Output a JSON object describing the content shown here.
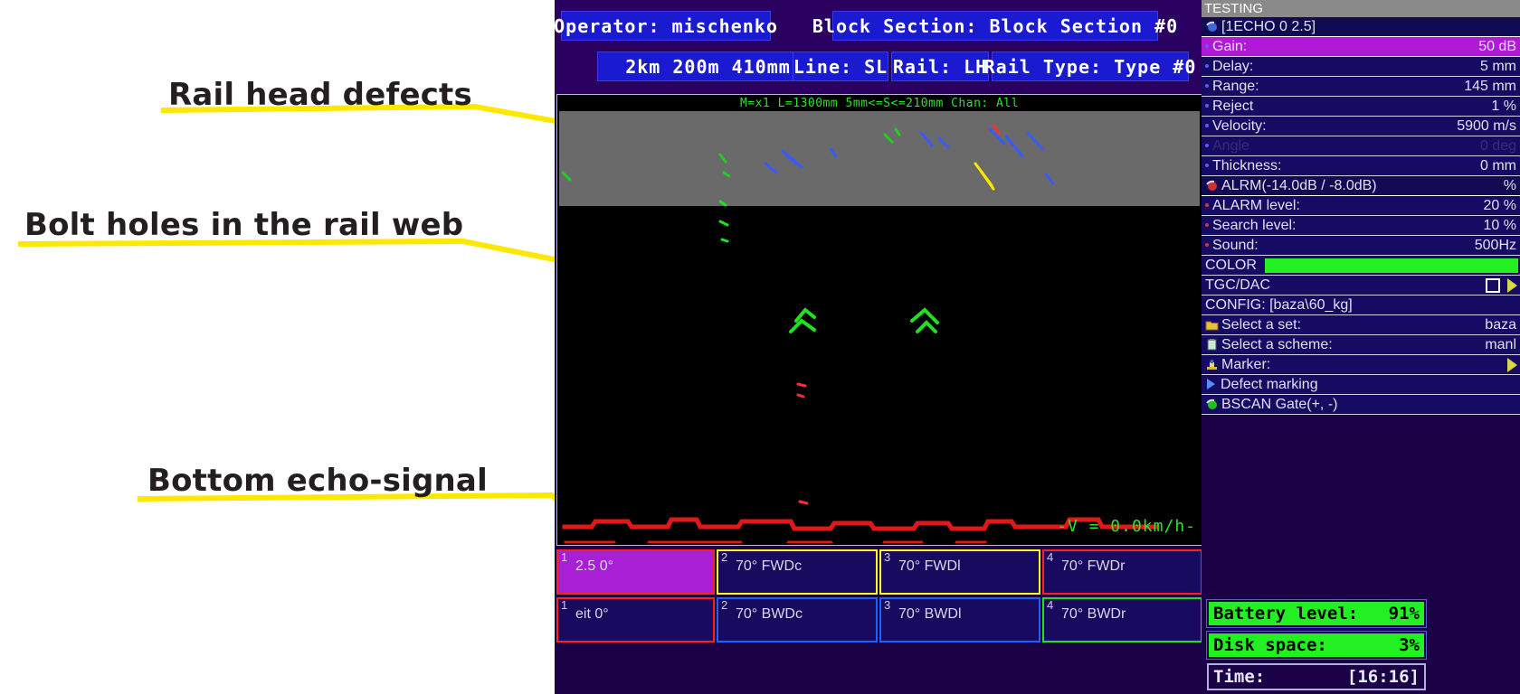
{
  "annotations": [
    {
      "text": "Rail head defects",
      "name": "annotation-rail-head-defects"
    },
    {
      "text": "Bolt holes in the rail web",
      "name": "annotation-bolt-holes"
    },
    {
      "text": "Bottom echo-signal",
      "name": "annotation-bottom-echo"
    }
  ],
  "colors": {
    "annotation_line": "#ffe800",
    "panel_bg": "#1b0246",
    "row_bg": "#160b62",
    "selected_row": "#b01ad6",
    "status_green": "#22f022",
    "bscan_head_bg": "#6a6a6a",
    "header_field_bg": "#1a1ad0"
  },
  "header": {
    "operator": "Operator: mischenko",
    "block_section": "Block Section: Block Section #0",
    "position": "2km  200m  410mm",
    "line": "Line: SL",
    "rail": "Rail: LH",
    "rail_type": "Rail Type: Type #0"
  },
  "bscan": {
    "title": "M=x1  L=1300mm 5mm<=S<=210mm Chan: All",
    "speed": "-V = 0.0km/h-"
  },
  "panel": {
    "title": "TESTING",
    "echo_header": "[1ECHO 0 2.5]",
    "rows": [
      {
        "name": "Gain:",
        "value": "50 dB",
        "selected": true,
        "bullet": "blue"
      },
      {
        "name": "Delay:",
        "value": "5 mm",
        "selected": false,
        "bullet": "blue"
      },
      {
        "name": "Range:",
        "value": "145 mm",
        "selected": false,
        "bullet": "blue"
      },
      {
        "name": "Reject",
        "value": "1 %",
        "selected": false,
        "bullet": "blue"
      },
      {
        "name": "Velocity:",
        "value": "5900 m/s",
        "selected": false,
        "bullet": "blue"
      },
      {
        "name": "Angle",
        "value": "0 deg",
        "selected": false,
        "bullet": "blue",
        "dim": true
      },
      {
        "name": "Thickness:",
        "value": "0 mm",
        "selected": false,
        "bullet": "blue"
      }
    ],
    "alarm_header": {
      "name": "ALRM(-14.0dB / -8.0dB)",
      "value": "%"
    },
    "alarm_rows": [
      {
        "name": "ALARM level:",
        "value": "20 %",
        "bullet": "red"
      },
      {
        "name": "Search level:",
        "value": "10 %",
        "bullet": "red"
      },
      {
        "name": "Sound:",
        "value": "500Hz",
        "bullet": "red"
      }
    ],
    "color_row": {
      "name": "COLOR",
      "swatch": "#22f022"
    },
    "tgcdac_row": {
      "name": "TGC/DAC"
    },
    "config_row": {
      "name": "CONFIG: [baza\\60_kg]"
    },
    "set_row": {
      "name": "Select a set:",
      "value": "baza",
      "icon": "folder-icon"
    },
    "scheme_row": {
      "name": "Select a scheme:",
      "value": "manl",
      "icon": "clipboard-icon"
    },
    "marker_row": {
      "name": "Marker:",
      "icon": "marker-icon"
    },
    "defect_row": {
      "name": "Defect marking",
      "icon": "play-arrow-icon"
    },
    "gate_row": {
      "name": "BSCAN Gate(+, -)",
      "icon": "gate-icon"
    }
  },
  "status": {
    "battery": {
      "label": "Battery level:",
      "value": "91%"
    },
    "disk": {
      "label": "Disk space:",
      "value": "3%"
    },
    "time": {
      "label": "Time:",
      "value": "[16:16]"
    }
  },
  "channels": {
    "row1": [
      {
        "num": "1",
        "label": "2.5 0°",
        "active": true,
        "border": "#ff2020"
      },
      {
        "num": "2",
        "label": "70° FWDc",
        "active": false,
        "border": "#ffff20"
      },
      {
        "num": "3",
        "label": "70° FWDl",
        "active": false,
        "border": "#ffff20"
      },
      {
        "num": "4",
        "label": "70° FWDr",
        "active": false,
        "border": "#ff2020"
      }
    ],
    "row2": [
      {
        "num": "1",
        "label": "eit 0°",
        "active": false,
        "border": "#ff2020"
      },
      {
        "num": "2",
        "label": "70° BWDc",
        "active": false,
        "border": "#2060ff"
      },
      {
        "num": "3",
        "label": "70° BWDl",
        "active": false,
        "border": "#2060ff"
      },
      {
        "num": "4",
        "label": "70° BWDr",
        "active": false,
        "border": "#20e020"
      }
    ]
  }
}
